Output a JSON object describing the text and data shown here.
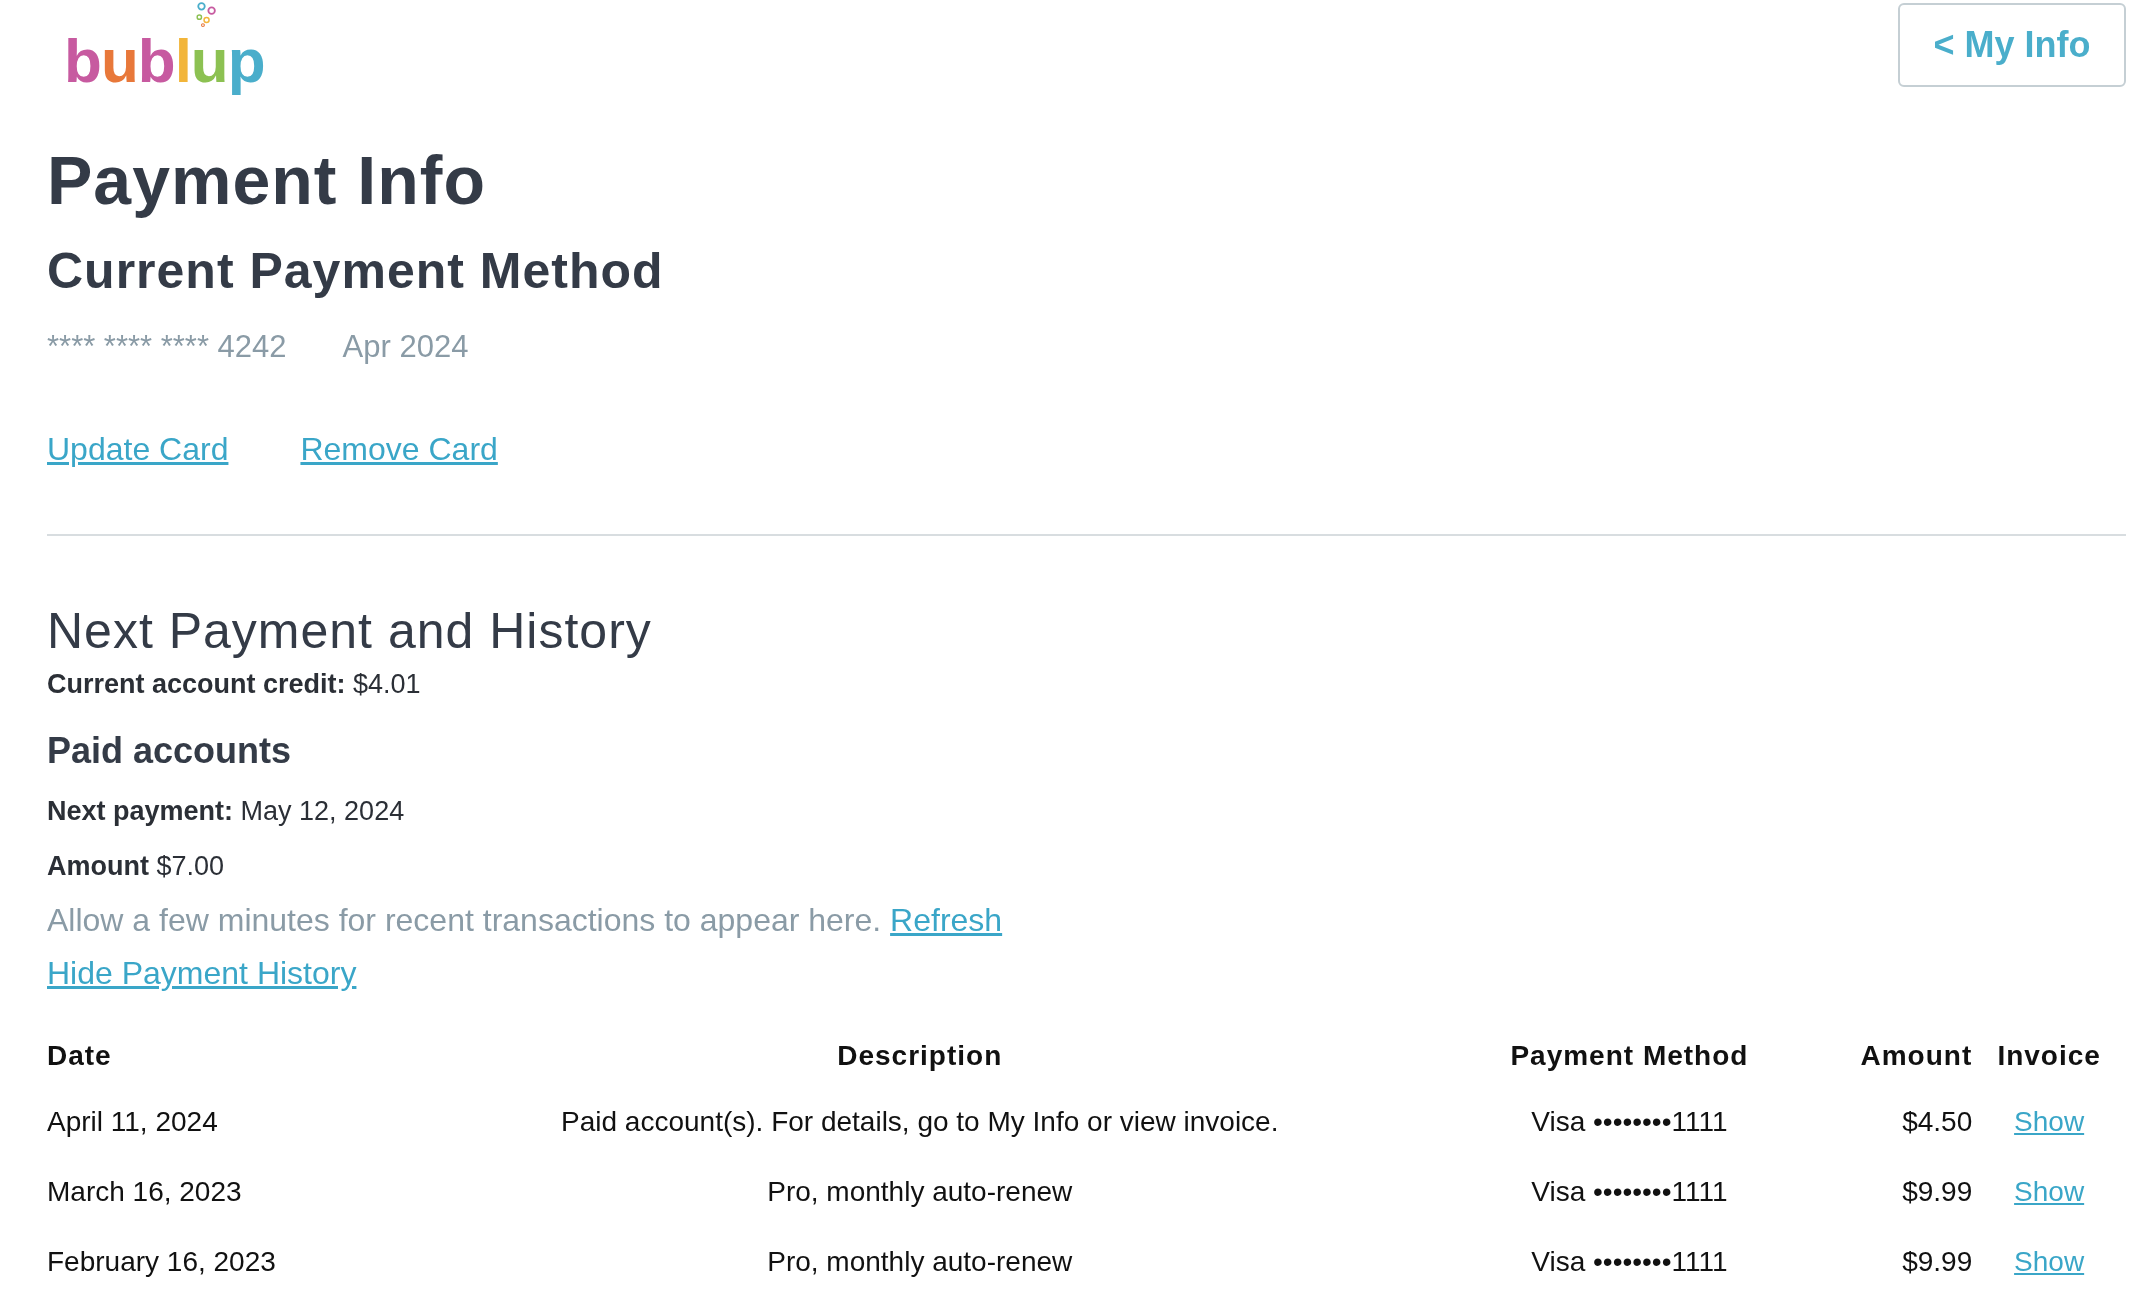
{
  "logo": {
    "text": "bublup"
  },
  "back_button": {
    "label": "< My Info"
  },
  "title": "Payment Info",
  "current_method": {
    "heading": "Current Payment Method",
    "card_number": "**** **** **** 4242",
    "expiry": "Apr 2024",
    "links": [
      "Update Card",
      "Remove Card"
    ]
  },
  "history": {
    "heading": "Next Payment and History",
    "credit": {
      "label": "Current account credit:",
      "value": "$4.01"
    },
    "subheading": "Paid accounts",
    "next_payment": {
      "label": "Next payment:",
      "value": "May 12, 2024"
    },
    "amount": {
      "label": "Amount",
      "value": "$7.00"
    },
    "notice": "Allow a few minutes for recent transactions to appear here.",
    "refresh_link": "Refresh",
    "toggle_link": "Hide Payment History",
    "table": {
      "columns": [
        "Date",
        "Description",
        "Payment Method",
        "Amount",
        "Invoice"
      ],
      "rows": [
        {
          "date": "April 11, 2024",
          "description": "Paid account(s). For details, go to My Info or view invoice.",
          "method": "Visa ••••••••1111",
          "amount": "$4.50",
          "invoice": "Show"
        },
        {
          "date": "March 16, 2023",
          "description": "Pro, monthly auto-renew",
          "method": "Visa ••••••••1111",
          "amount": "$9.99",
          "invoice": "Show"
        },
        {
          "date": "February 16, 2023",
          "description": "Pro, monthly auto-renew",
          "method": "Visa ••••••••1111",
          "amount": "$9.99",
          "invoice": "Show"
        }
      ]
    }
  }
}
